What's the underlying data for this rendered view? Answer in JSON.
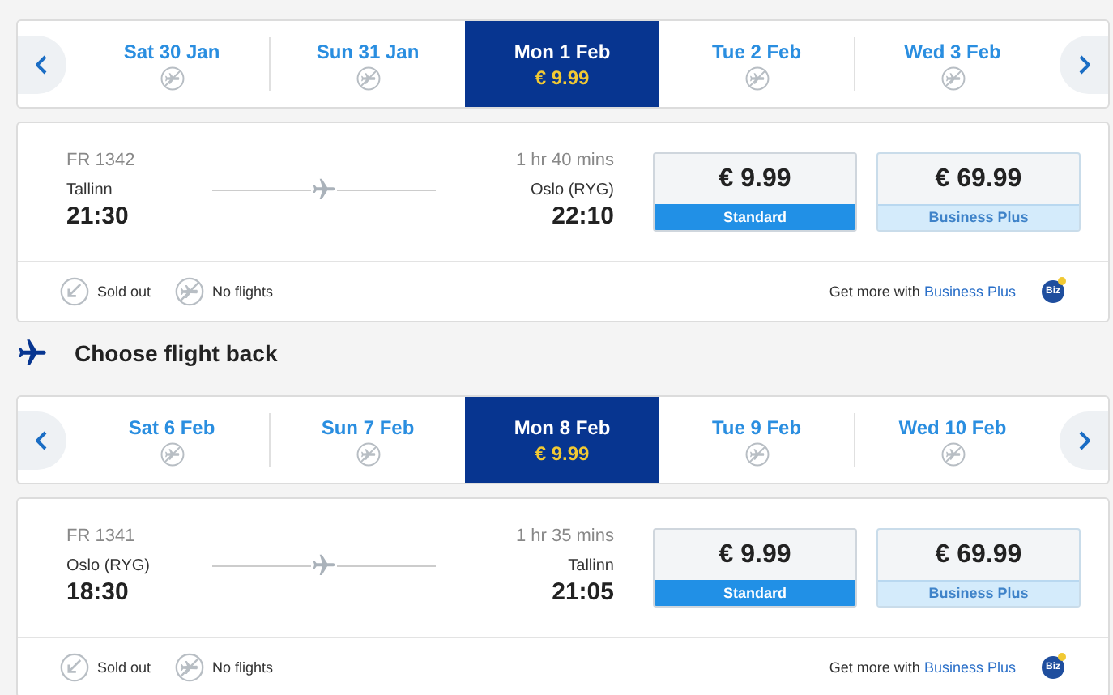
{
  "outbound": {
    "dates": [
      {
        "label": "Sat 30 Jan",
        "selected": false
      },
      {
        "label": "Sun 31 Jan",
        "selected": false
      },
      {
        "label": "Mon 1 Feb",
        "price": "€ 9.99",
        "selected": true
      },
      {
        "label": "Tue 2 Feb",
        "selected": false
      },
      {
        "label": "Wed 3 Feb",
        "selected": false
      }
    ],
    "flight": {
      "number": "FR 1342",
      "origin": "Tallinn",
      "departure": "21:30",
      "duration": "1 hr 40 mins",
      "destination": "Oslo (RYG)",
      "arrival": "22:10"
    },
    "fares": [
      {
        "price": "€ 9.99",
        "label": "Standard",
        "selected": true
      },
      {
        "price": "€ 69.99",
        "label": "Business Plus",
        "selected": false
      }
    ],
    "legend": [
      {
        "kind": "sold_out",
        "label": "Sold out"
      },
      {
        "kind": "no_flights",
        "label": "No flights"
      }
    ],
    "promo": {
      "text": "Get more with",
      "link": "Business Plus",
      "badge": "Biz"
    }
  },
  "return_heading": "Choose flight back",
  "return": {
    "dates": [
      {
        "label": "Sat 6 Feb",
        "selected": false
      },
      {
        "label": "Sun 7 Feb",
        "selected": false
      },
      {
        "label": "Mon 8 Feb",
        "price": "€ 9.99",
        "selected": true
      },
      {
        "label": "Tue 9 Feb",
        "selected": false
      },
      {
        "label": "Wed 10 Feb",
        "selected": false
      }
    ],
    "flight": {
      "number": "FR 1341",
      "origin": "Oslo (RYG)",
      "departure": "18:30",
      "duration": "1 hr 35 mins",
      "destination": "Tallinn",
      "arrival": "21:05"
    },
    "fares": [
      {
        "price": "€ 9.99",
        "label": "Standard",
        "selected": true
      },
      {
        "price": "€ 69.99",
        "label": "Business Plus",
        "selected": false
      }
    ],
    "legend": [
      {
        "kind": "sold_out",
        "label": "Sold out"
      },
      {
        "kind": "no_flights",
        "label": "No flights"
      }
    ],
    "promo": {
      "text": "Get more with",
      "link": "Business Plus",
      "badge": "Biz"
    }
  }
}
